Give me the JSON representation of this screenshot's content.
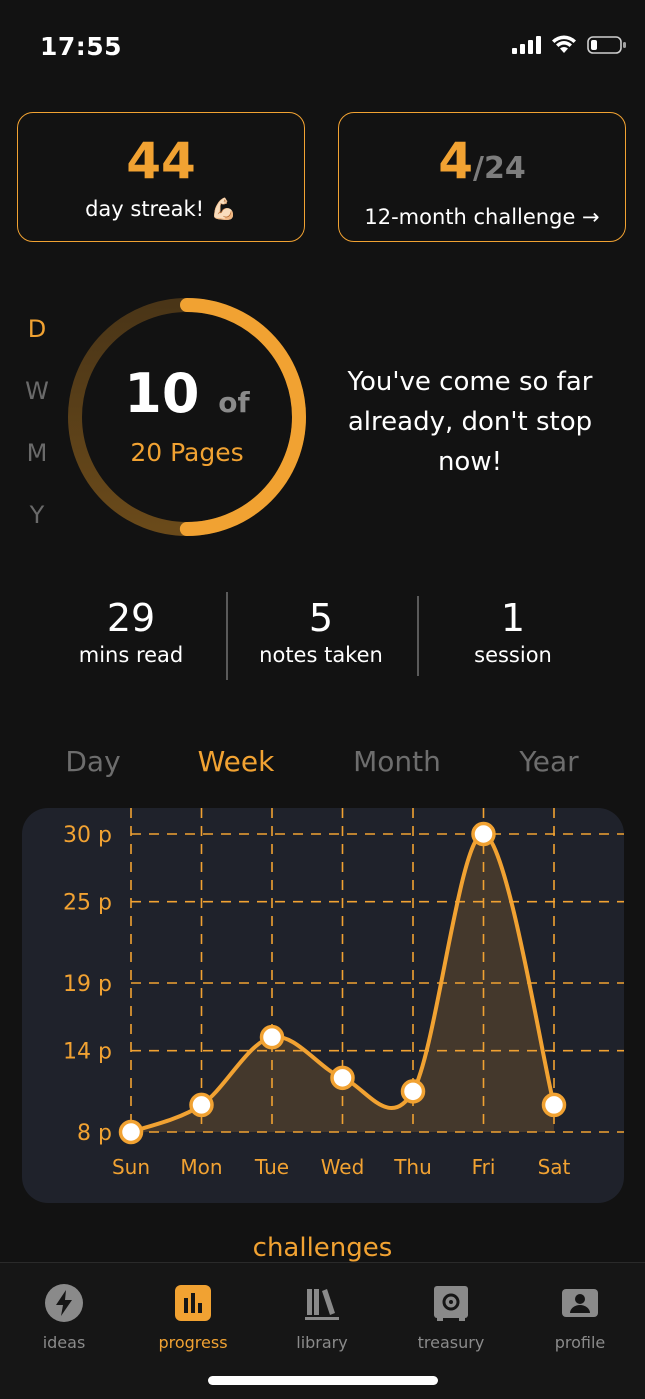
{
  "status_bar": {
    "time": "17:55"
  },
  "streak_card": {
    "value": "44",
    "label": "day streak! 💪🏻"
  },
  "challenge_card": {
    "value": "4",
    "denominator": "/24",
    "label": "12-month challenge →"
  },
  "period_switch": [
    "D",
    "W",
    "M",
    "Y"
  ],
  "ring": {
    "value": "10",
    "of": "of",
    "unit": "20 Pages",
    "progress": 0.5
  },
  "motivation": "You've come so far already, don't stop now!",
  "metrics": [
    {
      "value": "29",
      "label": "mins read"
    },
    {
      "value": "5",
      "label": "notes taken"
    },
    {
      "value": "1",
      "label": "session"
    }
  ],
  "range_tabs": [
    "Day",
    "Week",
    "Month",
    "Year"
  ],
  "chart_data": {
    "type": "area",
    "categories": [
      "Sun",
      "Mon",
      "Tue",
      "Wed",
      "Thu",
      "Fri",
      "Sat"
    ],
    "values": [
      8,
      10,
      15,
      12,
      11,
      30,
      10
    ],
    "y_ticks": [
      "8 p",
      "14 p",
      "19 p",
      "25 p",
      "30 p"
    ],
    "y_tick_values": [
      8,
      14,
      19,
      25,
      30
    ],
    "ylim": [
      8,
      30
    ],
    "grid": true,
    "color": "#f1a232"
  },
  "section_peek": "challenges",
  "tab_bar": [
    {
      "icon": "bolt-icon",
      "label": "ideas"
    },
    {
      "icon": "bar-chart-icon",
      "label": "progress"
    },
    {
      "icon": "books-icon",
      "label": "library"
    },
    {
      "icon": "safe-icon",
      "label": "treasury"
    },
    {
      "icon": "id-card-icon",
      "label": "profile"
    }
  ],
  "colors": {
    "accent": "#f1a232",
    "background": "#121212",
    "panel": "#1f222b"
  }
}
